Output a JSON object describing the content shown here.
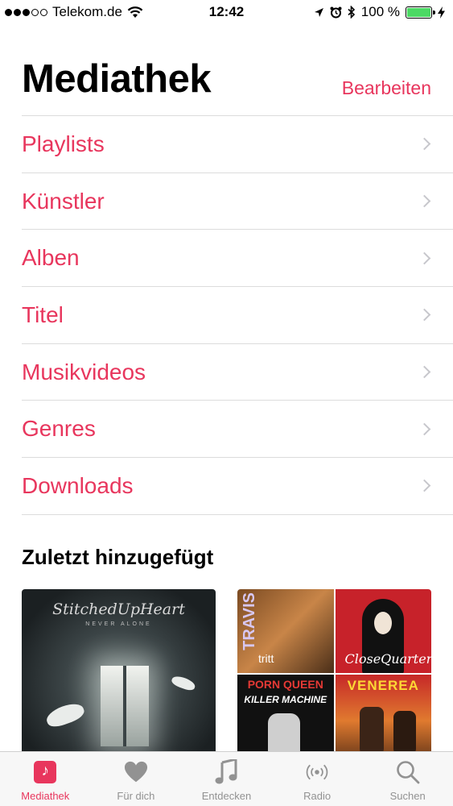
{
  "status_bar": {
    "carrier": "Telekom.de",
    "time": "12:42",
    "battery": "100 %",
    "battery_level": 1.0
  },
  "header": {
    "title": "Mediathek",
    "edit_label": "Bearbeiten"
  },
  "menu": {
    "items": [
      {
        "label": "Playlists"
      },
      {
        "label": "Künstler"
      },
      {
        "label": "Alben"
      },
      {
        "label": "Titel"
      },
      {
        "label": "Musikvideos"
      },
      {
        "label": "Genres"
      },
      {
        "label": "Downloads"
      }
    ]
  },
  "recent": {
    "title": "Zuletzt hinzugefügt",
    "albums": [
      {
        "cover_text": "StitchedUpHeart",
        "cover_sub": "NEVER ALONE"
      },
      {
        "cover_text": "TRAVIS",
        "cover_sub": "tritt"
      },
      {
        "cover_text": "CloseQuarters"
      },
      {
        "cover_text": "PORN QUEEN",
        "cover_sub": "KILLER MACHINE"
      },
      {
        "cover_text": "VENEREA"
      }
    ]
  },
  "tab_bar": {
    "tabs": [
      {
        "label": "Mediathek",
        "icon": "library-icon"
      },
      {
        "label": "Für dich",
        "icon": "heart-icon"
      },
      {
        "label": "Entdecken",
        "icon": "music-note-icon"
      },
      {
        "label": "Radio",
        "icon": "radio-icon"
      },
      {
        "label": "Suchen",
        "icon": "search-icon"
      }
    ],
    "active_index": 0
  },
  "colors": {
    "accent": "#e8365d",
    "inactive": "#929292",
    "battery": "#4cd964"
  }
}
